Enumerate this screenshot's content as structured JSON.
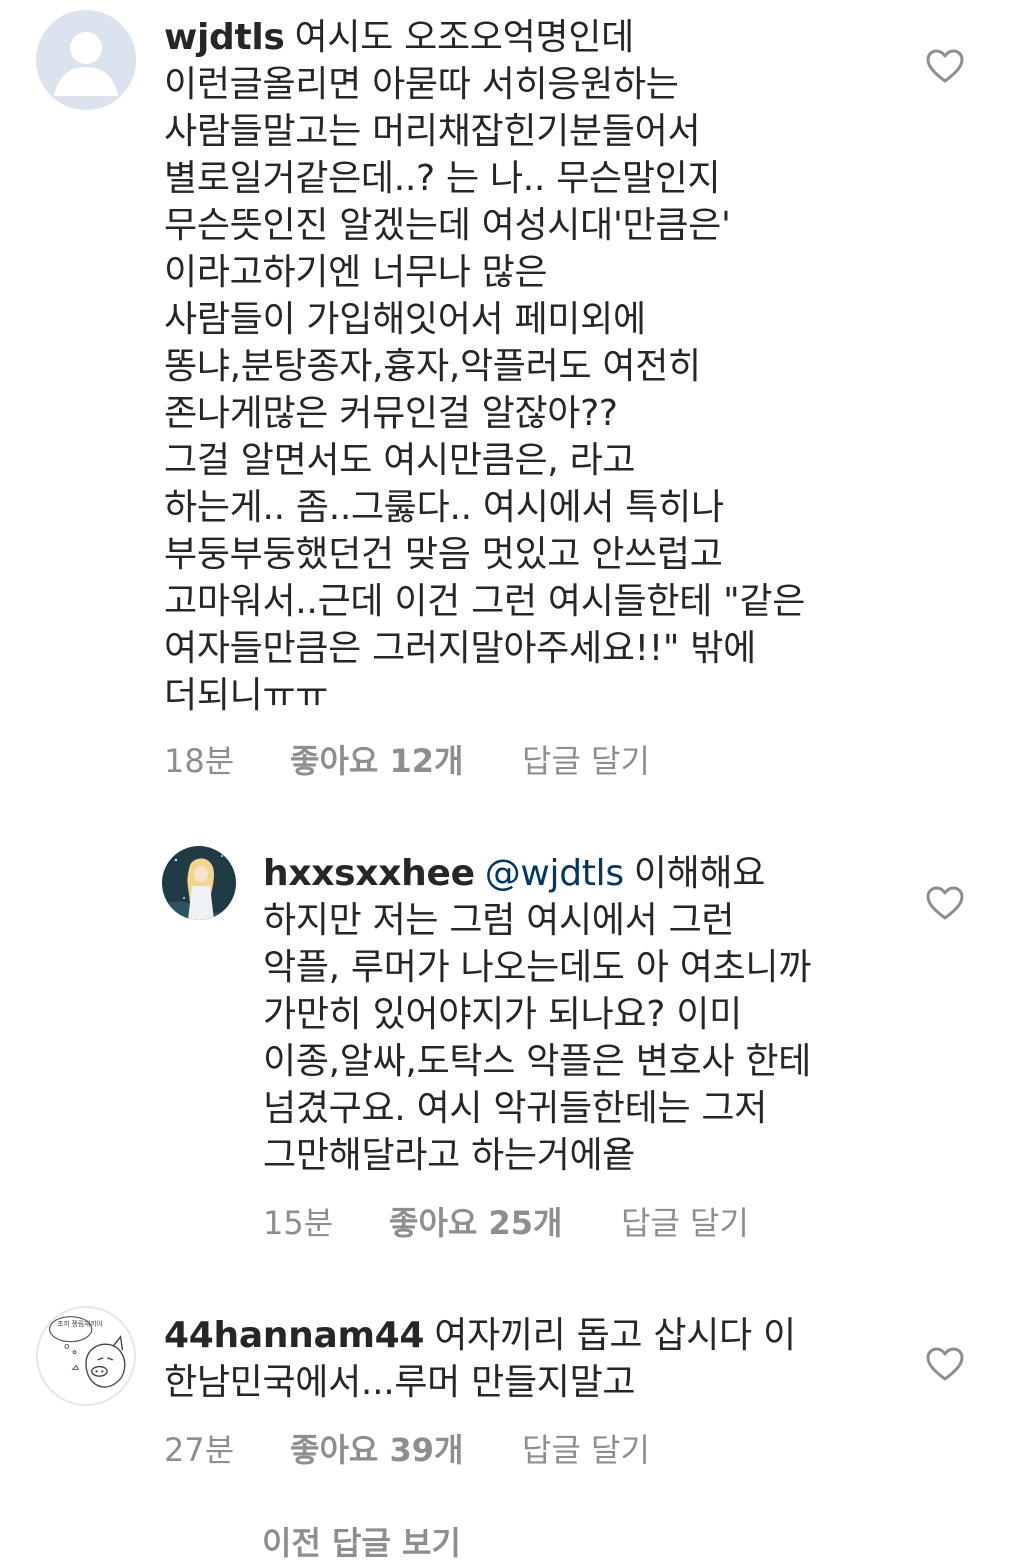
{
  "colors": {
    "text": "#262626",
    "meta": "#8e8e8e",
    "mention": "#00376b",
    "heart_outline": "#8e8e8e"
  },
  "comments": [
    {
      "username": "wjdtls",
      "text": "여시도 오조오억명인데\n이런글올리면 아묻따 서히응원하는\n사람들말고는 머리채잡힌기분들어서\n별로일거같은데..? 는 나.. 무슨말인지\n무슨뜻인진 알겠는데 여성시대'만큼은'\n이라고하기엔 너무나 많은\n사람들이 가입해잇어서 페미외에\n똥냐,분탕종자,흉자,악플러도 여전히\n존나게많은 커뮤인걸 알잖아??\n그걸 알면서도 여시만큼은, 라고\n하는게.. 좀..그룷다.. 여시에서 특히나\n부둥부둥했던건 맞음 멋있고 안쓰럽고\n고마워서..근데 이건 그런 여시들한테 \"같은\n여자들만큼은 그러지말아주세요!!\" 밖에\n더되니ㅠㅠ",
      "time": "18분",
      "likes": "좋아요 12개",
      "reply": "답글 달기",
      "avatar_icon": "default-profile-icon",
      "like_icon": "heart-outline-icon"
    },
    {
      "username": "hxxsxxhee",
      "mention": "@wjdtls",
      "text": "이해해요\n하지만 저는 그럼 여시에서 그런\n악플, 루머가 나오는데도 아 여초니까\n가만히 있어야지가 되나요? 이미\n이종,알싸,도탁스 악플은 변호사 한테\n넘겼구요. 여시 악귀들한테는 그저\n그만해달라고 하는거에욭",
      "time": "15분",
      "likes": "좋아요 25개",
      "reply": "답글 달기",
      "avatar_icon": "anime-girl-avatar",
      "like_icon": "heart-outline-icon"
    },
    {
      "username": "44hannam44",
      "text": "여자끼리 돕고 삽시다 이\n한남민국에서...루머 만들지말고",
      "time": "27분",
      "likes": "좋아요 39개",
      "reply": "답글 달기",
      "avatar_icon": "pig-sketch-avatar",
      "avatar_text": "조까\n젱림새끼야",
      "like_icon": "heart-outline-icon"
    }
  ],
  "footer": {
    "view_replies": "이전 답글 보기"
  }
}
